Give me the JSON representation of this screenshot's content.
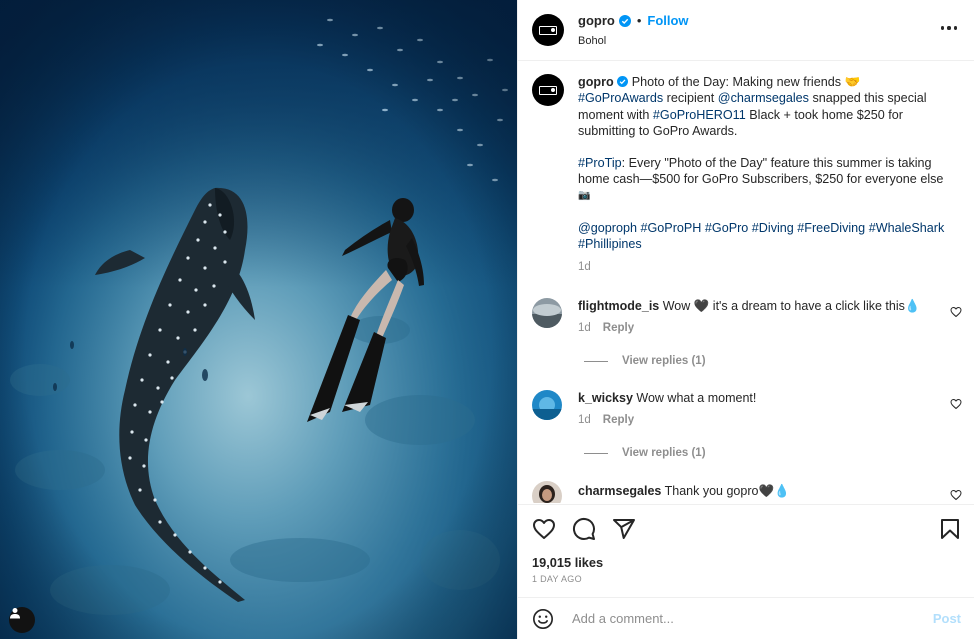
{
  "post": {
    "username": "gopro",
    "follow_label": "Follow",
    "separator": "•",
    "location": "Bohol",
    "avatar_icon": "gopro-logo",
    "brand_blue": "#0095f6"
  },
  "caption": {
    "username": "gopro",
    "line1_text": "Photo of the Day: Making new friends 🤝",
    "line2_tag": "#GoProAwards",
    "line2_text": " recipient ",
    "line2_mention": "@charmsegales",
    "line2_text2": " snapped this special",
    "line3_text": "moment with ",
    "line3_tag": "#GoProHERO11",
    "line3_text2": " Black + took home $250 for",
    "line4_text": "submitting to GoPro Awards.",
    "protip_tag": "#ProTip",
    "protip_text": ": Every \"Photo of the Day\" feature this summer is taking",
    "protip_line2": "home cash—$500 for GoPro Subscribers, $250 for everyone else",
    "protip_emoji": "📷",
    "tags_line1": "@goproph #GoProPH #GoPro #Diving #FreeDiving #WhaleShark",
    "tags_line2": "#Phillipines",
    "time": "1d"
  },
  "comments": [
    {
      "username": "flightmode_is",
      "text": " Wow 🖤 it's a dream to have a click like this💧",
      "time": "1d",
      "reply_label": "Reply",
      "view_replies": "View replies (1)"
    },
    {
      "username": "k_wicksy",
      "text": " Wow what a moment!",
      "time": "1d",
      "reply_label": "Reply",
      "view_replies": "View replies (1)"
    },
    {
      "username": "charmsegales",
      "text": " Thank you gopro🖤💧"
    }
  ],
  "actions": {
    "likes": "19,015 likes",
    "age": "1 DAY AGO",
    "comment_placeholder": "Add a comment...",
    "post_label": "Post",
    "icons": [
      "heart-icon",
      "comment-icon",
      "share-icon",
      "bookmark-icon",
      "emoji-icon"
    ]
  }
}
